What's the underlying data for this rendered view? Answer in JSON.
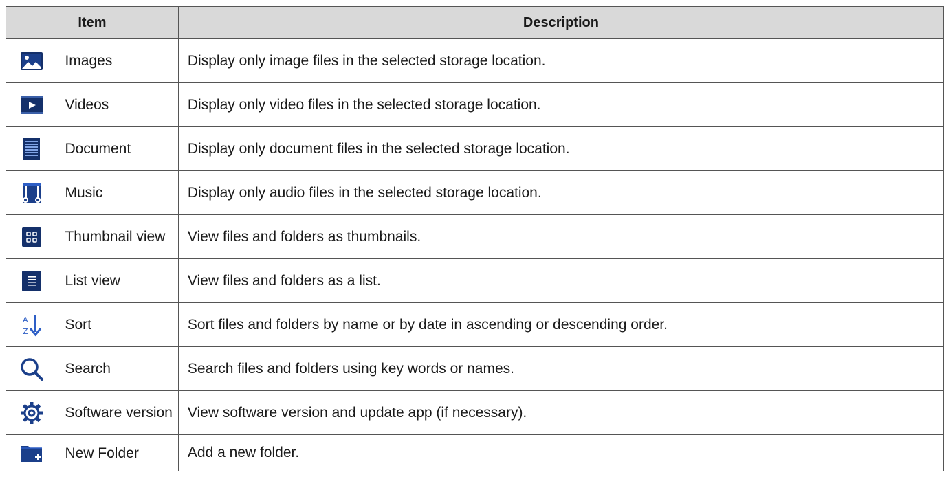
{
  "table": {
    "headers": {
      "item": "Item",
      "description": "Description"
    },
    "rows": [
      {
        "icon": "image-icon",
        "item": "Images",
        "description": "Display only image files in the selected storage location."
      },
      {
        "icon": "video-icon",
        "item": "Videos",
        "description": "Display only video files in the selected storage location."
      },
      {
        "icon": "document-icon",
        "item": "Document",
        "description": "Display only document files in the selected storage location."
      },
      {
        "icon": "music-icon",
        "item": "Music",
        "description": "Display only audio files in the selected storage location."
      },
      {
        "icon": "thumbnail-view-icon",
        "item": "Thumbnail view",
        "description": "View files and folders as thumbnails."
      },
      {
        "icon": "list-view-icon",
        "item": "List view",
        "description": "View files and folders as a list."
      },
      {
        "icon": "sort-icon",
        "item": "Sort",
        "description": "Sort files and folders by name or by date in ascending or descending order."
      },
      {
        "icon": "search-icon",
        "item": "Search",
        "description": "Search files and folders using key words or names."
      },
      {
        "icon": "gear-icon",
        "item": "Software version",
        "description": "View software version and update app (if necessary)."
      },
      {
        "icon": "new-folder-icon",
        "item": "New Folder",
        "description": "Add a new folder."
      }
    ]
  },
  "colors": {
    "icon_navy": "#14306a",
    "icon_blue": "#2e5fc6",
    "header_bg": "#d9d9d9"
  }
}
